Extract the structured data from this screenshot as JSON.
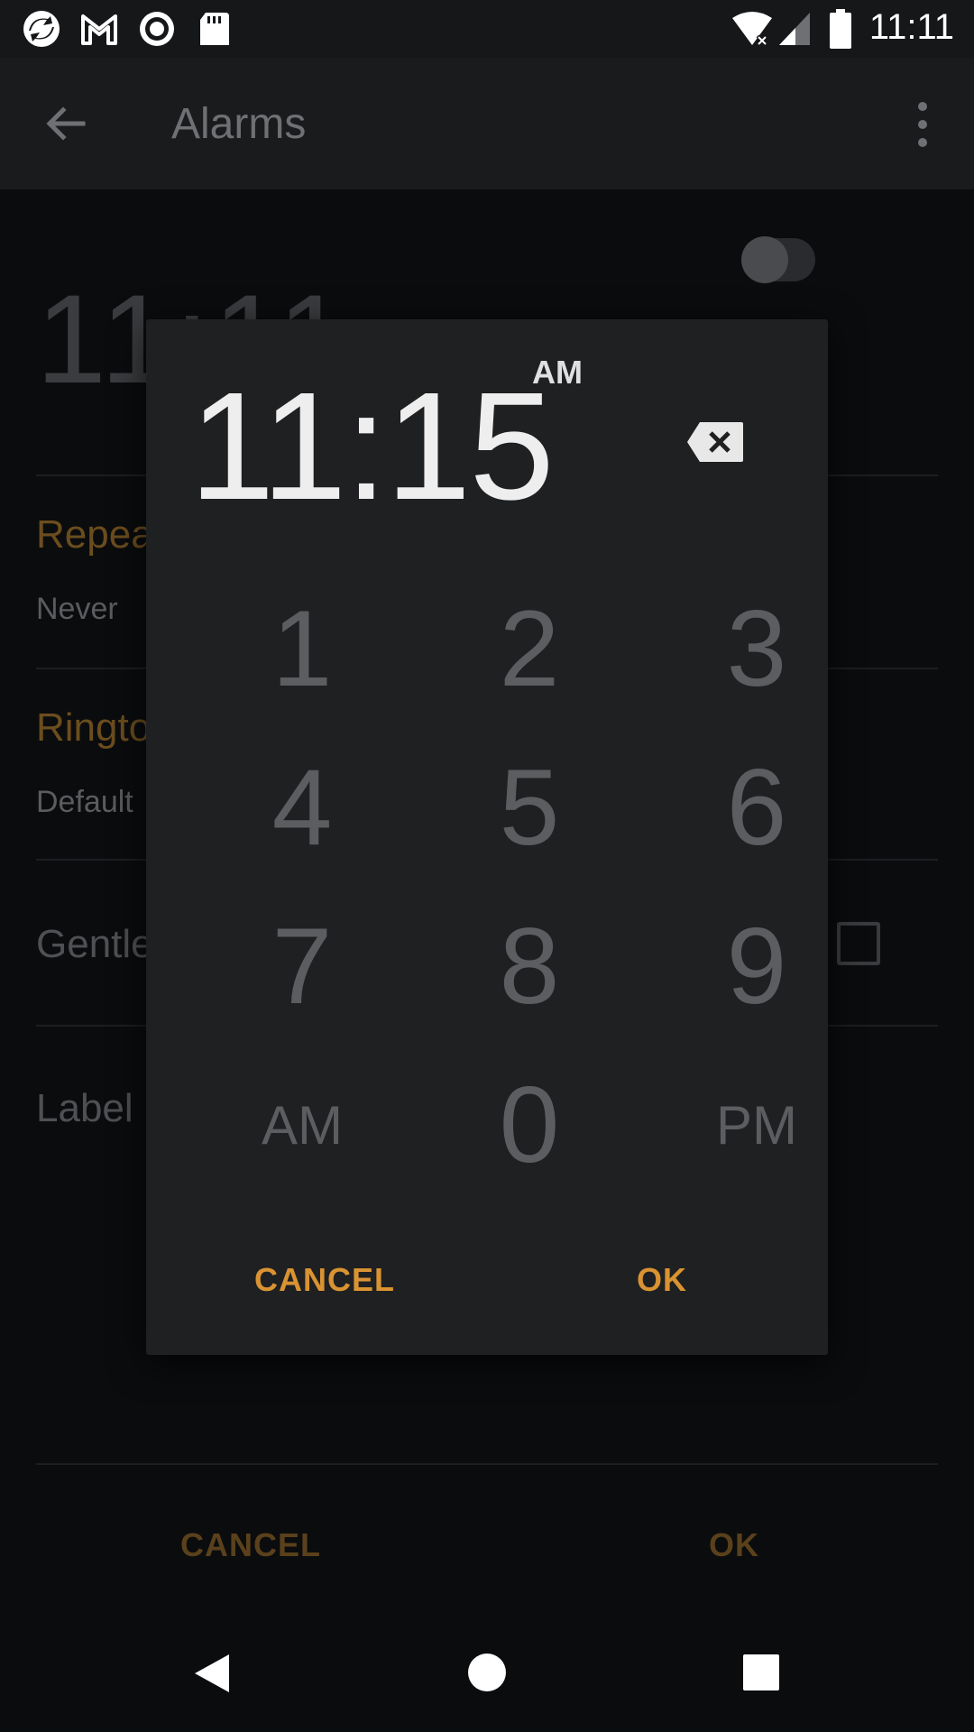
{
  "status_bar": {
    "time": "11:11",
    "left_icons": [
      "sync-icon",
      "gmail-icon",
      "record-icon",
      "sd-card-icon"
    ],
    "right_icons": [
      "wifi-icon",
      "signal-icon",
      "battery-icon"
    ]
  },
  "app_bar": {
    "title": "Alarms",
    "back_icon": "arrow-back-icon",
    "menu_icon": "more-vert-icon"
  },
  "background": {
    "alarm_time": "11:11",
    "repeat_label": "Repea",
    "repeat_value": "Never",
    "ringtone_label": "Ringto",
    "ringtone_value": "Default",
    "gentle_label": "Gentle",
    "label_label": "Label",
    "cancel": "CANCEL",
    "ok": "OK"
  },
  "dialog": {
    "entered_time": "11:15",
    "am_pm": "AM",
    "keys": [
      "1",
      "2",
      "3",
      "4",
      "5",
      "6",
      "7",
      "8",
      "9",
      "AM",
      "0",
      "PM"
    ],
    "cancel": "CANCEL",
    "ok": "OK"
  },
  "colors": {
    "accent": "#d99332",
    "background": "#0b0c0e",
    "dialog": "#1f2022"
  }
}
